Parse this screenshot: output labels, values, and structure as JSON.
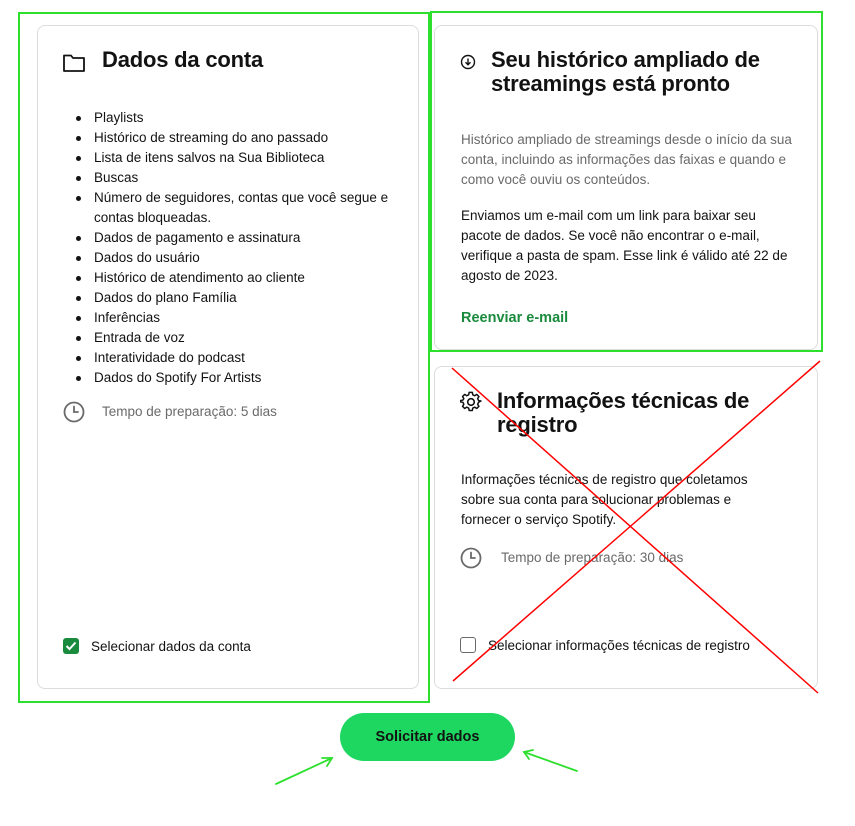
{
  "account_card": {
    "title": "Dados da conta",
    "icon": "folder-icon",
    "items": [
      "Playlists",
      "Histórico de streaming do ano passado",
      "Lista de itens salvos na Sua Biblioteca",
      "Buscas",
      "Número de seguidores, contas que você segue e contas bloqueadas.",
      "Dados de pagamento e assinatura",
      "Dados do usuário",
      "Histórico de atendimento ao cliente",
      "Dados do plano Família",
      "Inferências",
      "Entrada de voz",
      "Interatividade do podcast",
      "Dados do Spotify For Artists"
    ],
    "prep_time": "Tempo de preparação: 5 dias",
    "checkbox_label": "Selecionar dados da conta",
    "checked": true
  },
  "extended_card": {
    "title": "Seu histórico ampliado de streamings está pronto",
    "icon": "download-circle-icon",
    "description": "Histórico ampliado de streamings desde o início da sua conta, incluindo as informações das faixas e quando e como você ouviu os conteúdos.",
    "notice": "Enviamos um e-mail com um link para baixar seu pacote de dados. Se você não encontrar o e-mail, verifique a pasta de spam. Esse link é válido até 22 de agosto de 2023.",
    "resend_label": "Reenviar e-mail"
  },
  "technical_card": {
    "title": "Informações técnicas de registro",
    "icon": "gear-icon",
    "description": "Informações técnicas de registro que coletamos sobre sua conta para solucionar problemas e fornecer o serviço Spotify.",
    "prep_time": "Tempo de preparação: 30 dias",
    "checkbox_label": "Selecionar informações técnicas de registro",
    "checked": false
  },
  "request_button": "Solicitar dados",
  "colors": {
    "accent_green": "#1ed760",
    "link_green": "#1a8a3d",
    "annotation_green": "#2ee02e",
    "annotation_red": "#ff0000"
  }
}
